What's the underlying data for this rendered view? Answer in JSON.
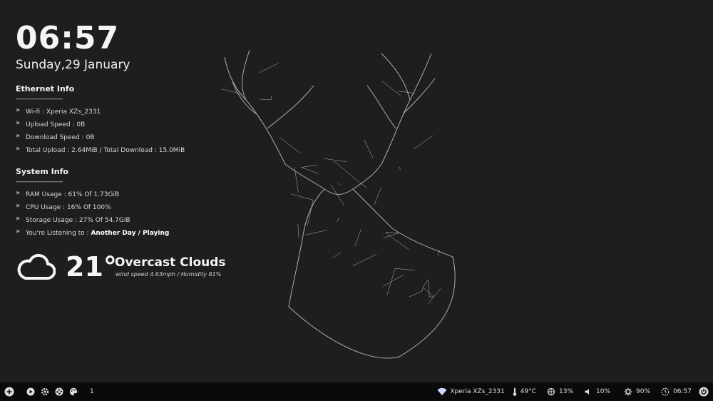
{
  "clock": {
    "time": "06:57",
    "date": "Sunday,29 January"
  },
  "ethernet": {
    "title": "Ethernet Info",
    "separator": "------------------------",
    "items": [
      "Wi-fi : Xperia XZs_2331",
      "Upload Speed : 0B",
      "Download Speed : 0B",
      "Total Upload : 2.64MiB / Total Download : 15.0MiB"
    ]
  },
  "system": {
    "title": "System Info",
    "separator": "------------------------",
    "items": [
      "RAM Usage : 61% Of 1.73GiB",
      "CPU Usage : 16% Of 100%",
      "Storage Usage : 27% Of 54.7GiB"
    ],
    "listening_label": "You're Listening to : ",
    "listening_track": "Another Day / Playing"
  },
  "weather": {
    "icon": "cloud-icon",
    "temperature": "21°",
    "condition": "Overcast Clouds",
    "details": "wind speed 4.63mph / Humidity 81%"
  },
  "taskbar": {
    "left_icons": [
      "add-icon",
      "play-icon",
      "gear-icon",
      "aperture-icon",
      "palette-icon"
    ],
    "workspace": "1",
    "wifi_name": "Xperia XZs_2331",
    "temperature": "49°C",
    "cpu": "13%",
    "volume": "10%",
    "brightness": "90%",
    "time": "06:57",
    "accent": "#ffffff"
  },
  "colors": {
    "background": "#1e1e1e",
    "taskbar": "#0a0a0a",
    "text": "#e8e8e8"
  }
}
